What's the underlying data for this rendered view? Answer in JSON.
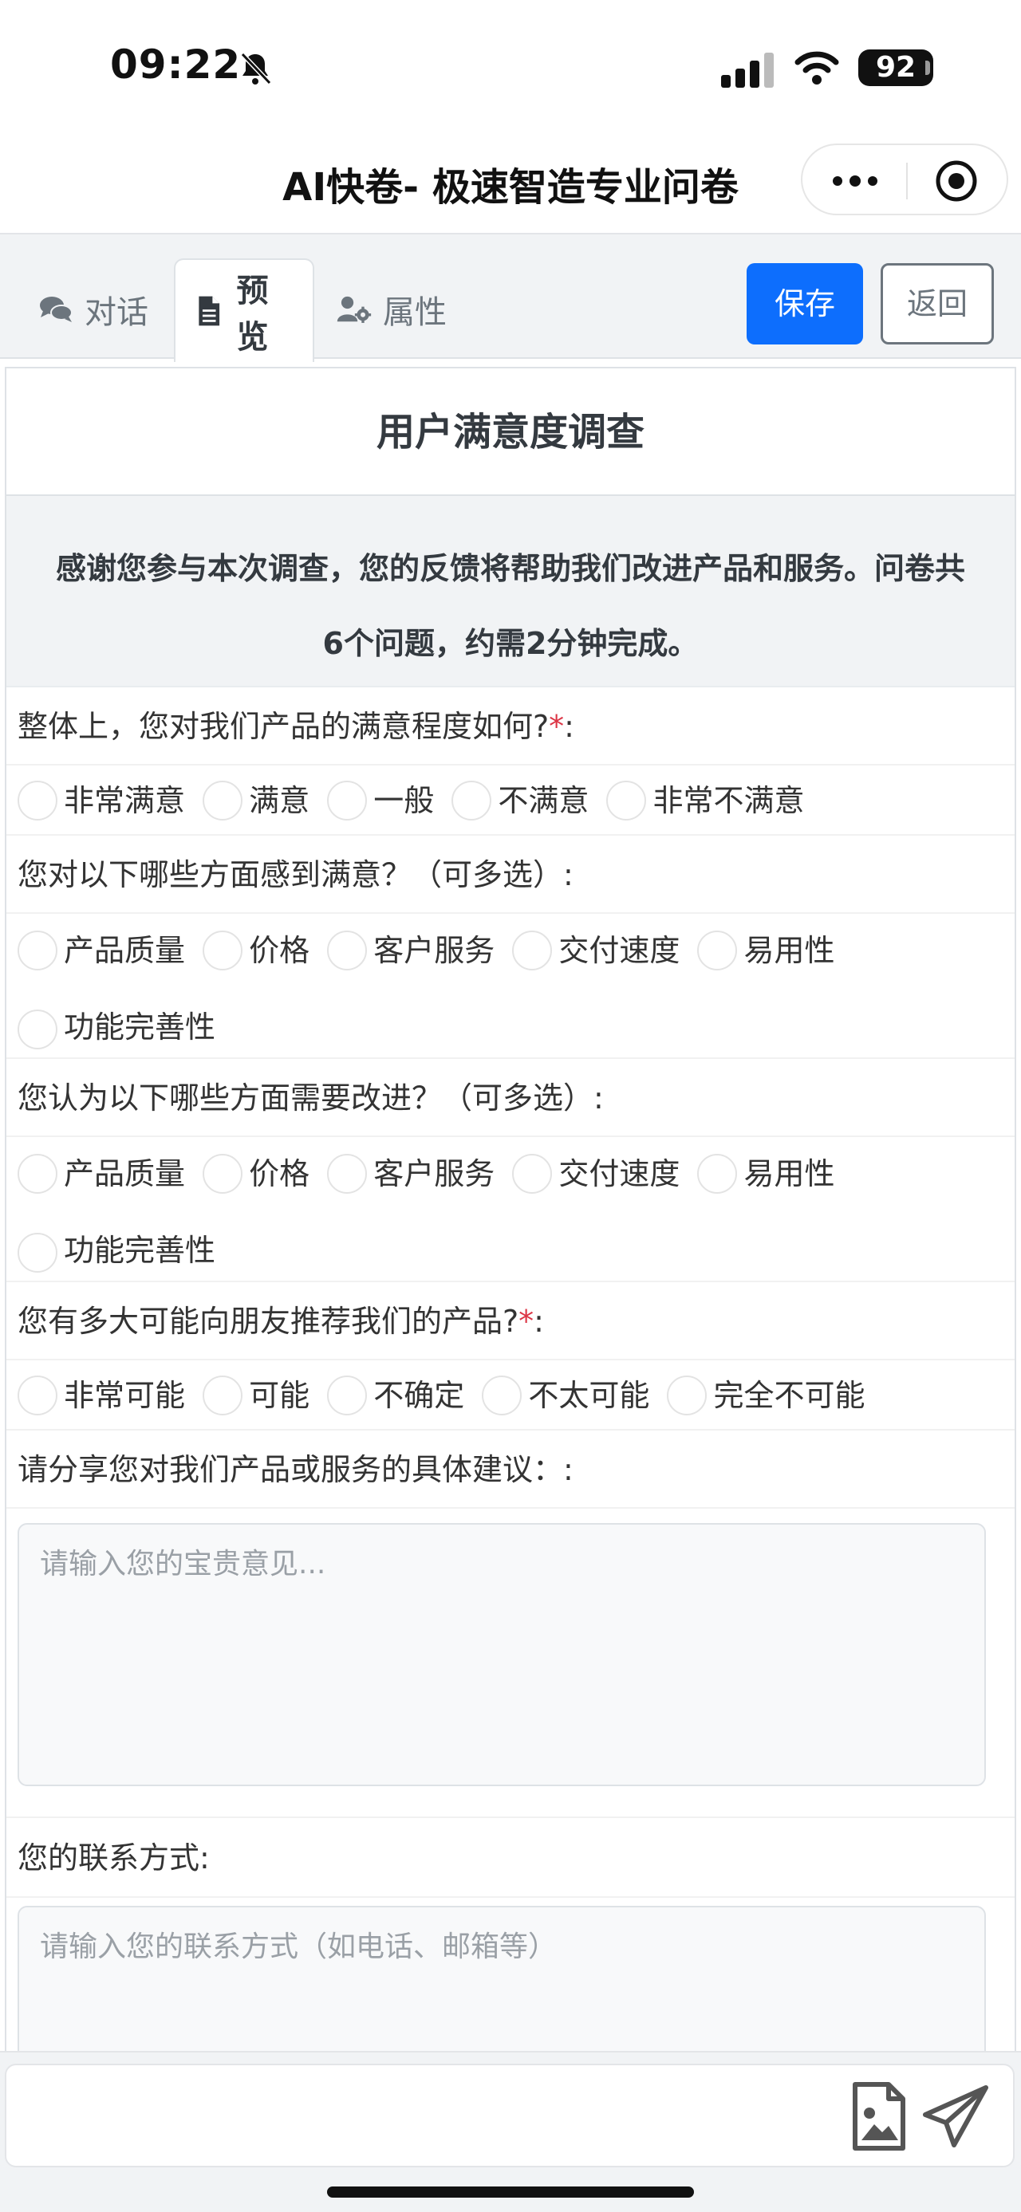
{
  "status_bar": {
    "time": "09:22",
    "battery": "92"
  },
  "header": {
    "title": "AI快卷- 极速智造专业问卷"
  },
  "toolbar": {
    "tabs": [
      {
        "label": "对话",
        "icon": "comments-icon"
      },
      {
        "label": "预览",
        "icon": "file-icon"
      },
      {
        "label": "属性",
        "icon": "user-gear-icon"
      }
    ],
    "active_tab": "预览",
    "save_label": "保存",
    "back_label": "返回"
  },
  "survey": {
    "title": "用户满意度调查",
    "description": "感谢您参与本次调查，您的反馈将帮助我们改进产品和服务。问卷共6个问题，约需2分钟完成。",
    "questions": [
      {
        "text": "整体上，您对我们产品的满意程度如何?",
        "required": true,
        "suffix": ":",
        "type": "radio",
        "options": [
          "非常满意",
          "满意",
          "一般",
          "不满意",
          "非常不满意"
        ]
      },
      {
        "text": "您对以下哪些方面感到满意？（可多选）:",
        "required": false,
        "type": "checkbox",
        "options": [
          "产品质量",
          "价格",
          "客户服务",
          "交付速度",
          "易用性",
          "功能完善性"
        ]
      },
      {
        "text": "您认为以下哪些方面需要改进？（可多选）:",
        "required": false,
        "type": "checkbox",
        "options": [
          "产品质量",
          "价格",
          "客户服务",
          "交付速度",
          "易用性",
          "功能完善性"
        ]
      },
      {
        "text": "您有多大可能向朋友推荐我们的产品?",
        "required": true,
        "suffix": ":",
        "type": "radio",
        "options": [
          "非常可能",
          "可能",
          "不确定",
          "不太可能",
          "完全不可能"
        ]
      },
      {
        "text": "请分享您对我们产品或服务的具体建议：:",
        "required": false,
        "type": "textarea",
        "placeholder": "请输入您的宝贵意见..."
      },
      {
        "text": "您的联系方式:",
        "required": false,
        "type": "text",
        "placeholder": "请输入您的联系方式（如电话、邮箱等）"
      }
    ],
    "required_mark": "*"
  },
  "colors": {
    "accent": "#0d6efd",
    "required": "#dc3545",
    "muted": "#6c757d"
  }
}
